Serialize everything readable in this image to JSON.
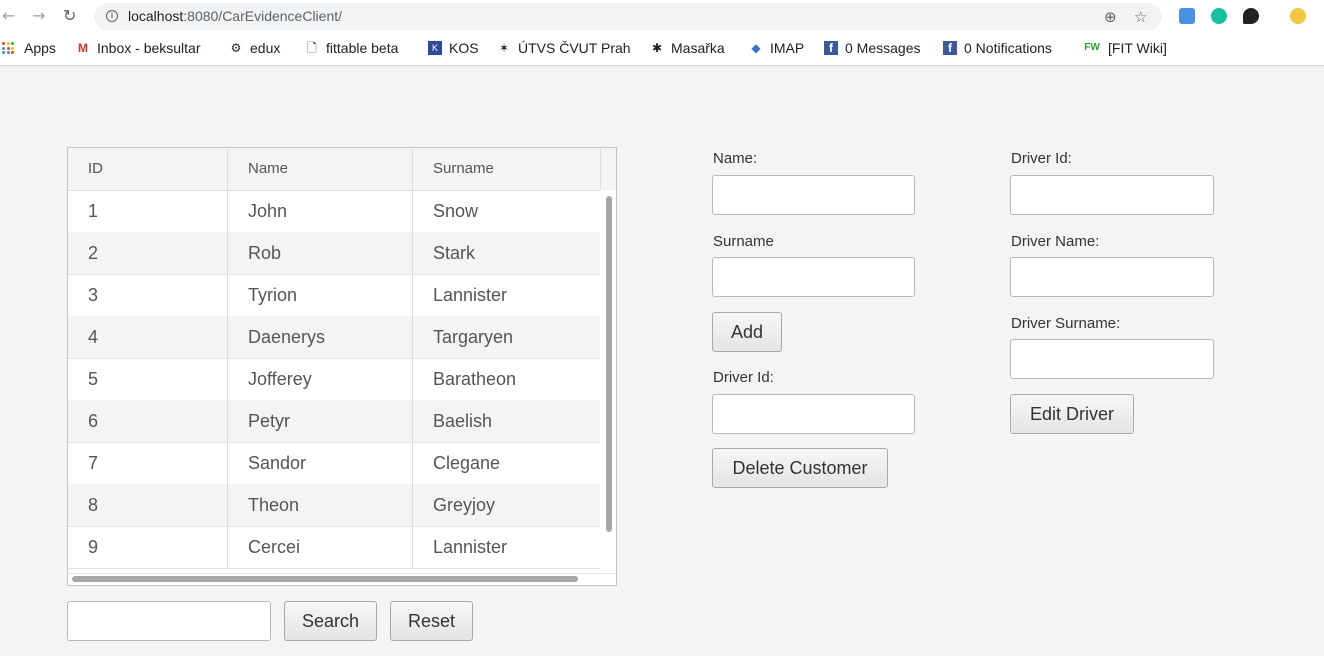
{
  "browser": {
    "url_host": "localhost",
    "url_rest": ":8080/CarEvidenceClient/",
    "bookmarks": [
      {
        "label": "Apps"
      },
      {
        "label": "Inbox - beksultar"
      },
      {
        "label": "edux"
      },
      {
        "label": "fittable beta"
      },
      {
        "label": "KOS"
      },
      {
        "label": "ÚTVS ČVUT Prah"
      },
      {
        "label": "Masařka"
      },
      {
        "label": "IMAP"
      },
      {
        "label": "0 Messages"
      },
      {
        "label": "0 Notifications"
      },
      {
        "label": "[FIT Wiki]"
      }
    ]
  },
  "table": {
    "columns": [
      "ID",
      "Name",
      "Surname"
    ],
    "rows": [
      {
        "id": "1",
        "name": "John",
        "surname": "Snow"
      },
      {
        "id": "2",
        "name": "Rob",
        "surname": "Stark"
      },
      {
        "id": "3",
        "name": "Tyrion",
        "surname": "Lannister"
      },
      {
        "id": "4",
        "name": "Daenerys",
        "surname": "Targaryen"
      },
      {
        "id": "5",
        "name": "Jofferey",
        "surname": "Baratheon"
      },
      {
        "id": "6",
        "name": "Petyr",
        "surname": "Baelish"
      },
      {
        "id": "7",
        "name": "Sandor",
        "surname": "Clegane"
      },
      {
        "id": "8",
        "name": "Theon",
        "surname": "Greyjoy"
      },
      {
        "id": "9",
        "name": "Cercei",
        "surname": "Lannister"
      }
    ]
  },
  "search": {
    "value": "",
    "search_label": "Search",
    "reset_label": "Reset"
  },
  "customer_form": {
    "name_label": "Name:",
    "name_value": "",
    "surname_label": "Surname",
    "surname_value": "",
    "add_label": "Add",
    "driver_id_label": "Driver Id:",
    "driver_id_value": "",
    "delete_label": "Delete Customer"
  },
  "driver_form": {
    "driver_id_label": "Driver Id:",
    "driver_id_value": "",
    "driver_name_label": "Driver Name:",
    "driver_name_value": "",
    "driver_surname_label": "Driver Surname:",
    "driver_surname_value": "",
    "edit_label": "Edit Driver"
  }
}
